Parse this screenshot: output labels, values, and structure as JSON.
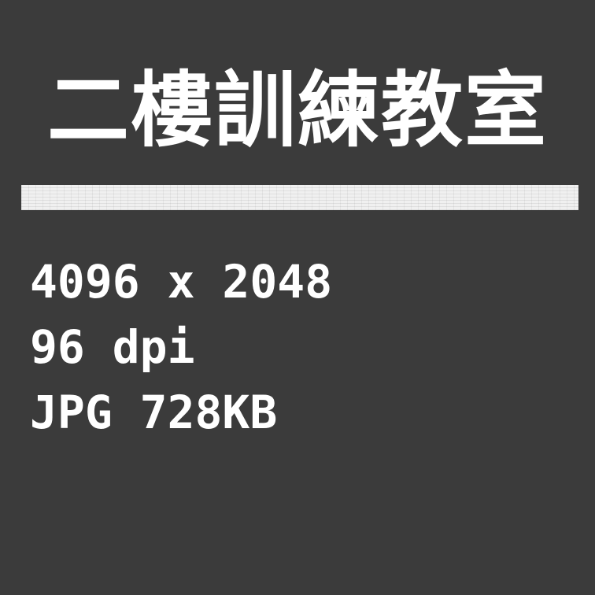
{
  "title": "二樓訓練教室",
  "image_info": {
    "resolution": "4096 x 2048",
    "dpi": "96 dpi",
    "format": "JPG 728KB"
  },
  "colors": {
    "background": "#3b3b3b",
    "text": "#ffffff",
    "strip": "#f0f0f0"
  }
}
